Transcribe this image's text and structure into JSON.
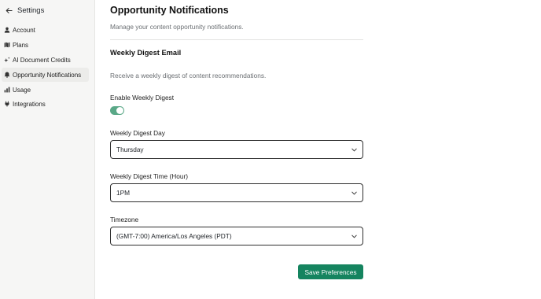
{
  "sidebar": {
    "title": "Settings",
    "items": [
      {
        "label": "Account",
        "icon": "person-icon"
      },
      {
        "label": "Plans",
        "icon": "map-icon"
      },
      {
        "label": "AI Document Credits",
        "icon": "sparkle-icon"
      },
      {
        "label": "Opportunity Notifications",
        "icon": "bell-icon",
        "active": true
      },
      {
        "label": "Usage",
        "icon": "bar-chart-icon"
      },
      {
        "label": "Integrations",
        "icon": "plug-icon"
      }
    ]
  },
  "page": {
    "title": "Opportunity Notifications",
    "subtitle": "Manage your content opportunity notifications."
  },
  "section": {
    "title": "Weekly Digest Email",
    "subtitle": "Receive a weekly digest of content recommendations."
  },
  "form": {
    "enable_label": "Enable Weekly Digest",
    "enable_value": true,
    "day_label": "Weekly Digest Day",
    "day_value": "Thursday",
    "time_label": "Weekly Digest Time (Hour)",
    "time_value": "1PM",
    "timezone_label": "Timezone",
    "timezone_value": "(GMT-7:00) America/Los Angeles (PDT)",
    "save_label": "Save Preferences"
  },
  "colors": {
    "accent": "#15845f",
    "toggle_on": "#5aa887",
    "sidebar_bg": "#f6f6f5",
    "active_item_bg": "#ececea"
  }
}
